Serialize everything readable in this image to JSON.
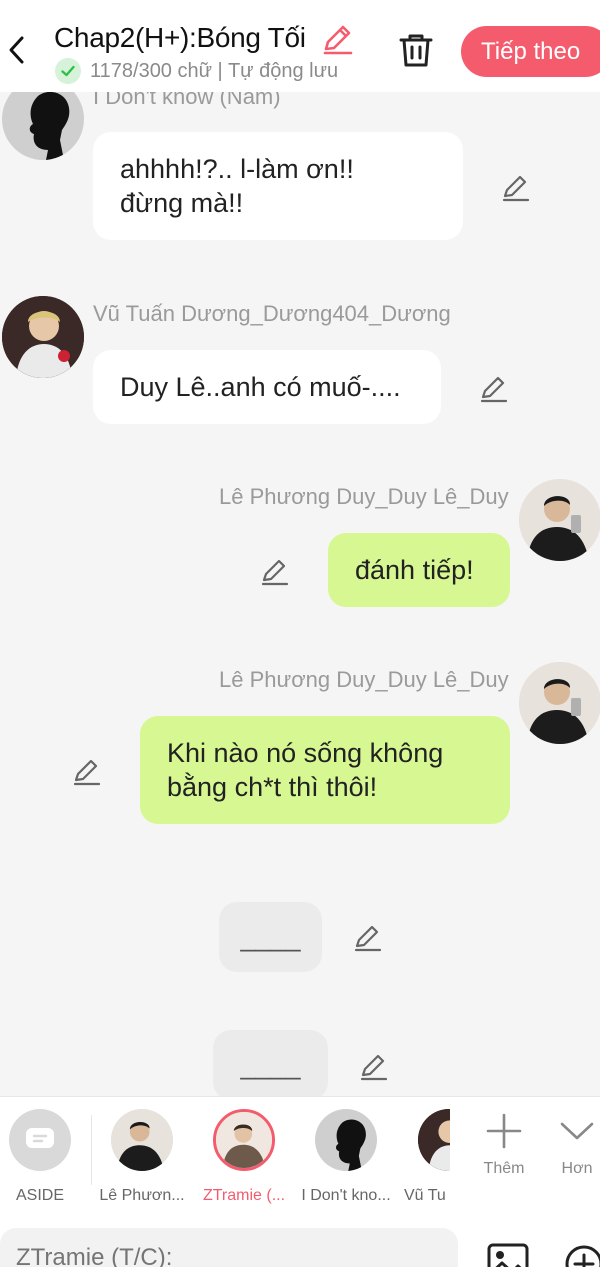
{
  "header": {
    "title": "Chap2(H+):Bóng Tối",
    "subtitle": "1178/300 chữ | Tự động lưu",
    "next_label": "Tiếp theo"
  },
  "messages": [
    {
      "name": "I Don't know (Nam)",
      "text": "ahhhh!?.. l-làm ơn!!\nđừng mà!!",
      "side": "left"
    },
    {
      "name": "Vũ Tuấn Dương_Dương404_Dương",
      "text": "Duy Lê..anh có muố-....",
      "side": "left"
    },
    {
      "name": "Lê Phương Duy_Duy Lê_Duy",
      "text": "đánh tiếp!",
      "side": "right"
    },
    {
      "name": "Lê Phương Duy_Duy Lê_Duy",
      "text": "Khi nào nó sống không\nbằng ch*t thì thôi!",
      "side": "right"
    },
    {
      "text": "____",
      "side": "center"
    },
    {
      "text": "____",
      "side": "center"
    }
  ],
  "character_bar": {
    "items": [
      {
        "label": "ASIDE",
        "icon": "chat-bubble-icon"
      },
      {
        "label": "Lê Phươn..."
      },
      {
        "label": "ZTramie (...",
        "selected": true
      },
      {
        "label": "I Don't kno..."
      },
      {
        "label": "Vũ Tu"
      }
    ],
    "add_label": "Thêm",
    "more_label": "Hơn"
  },
  "input": {
    "placeholder": "ZTramie (T/C):"
  },
  "colors": {
    "accent": "#f45c6e",
    "green_bubble": "#d7f792",
    "background": "#f5f5f5"
  }
}
